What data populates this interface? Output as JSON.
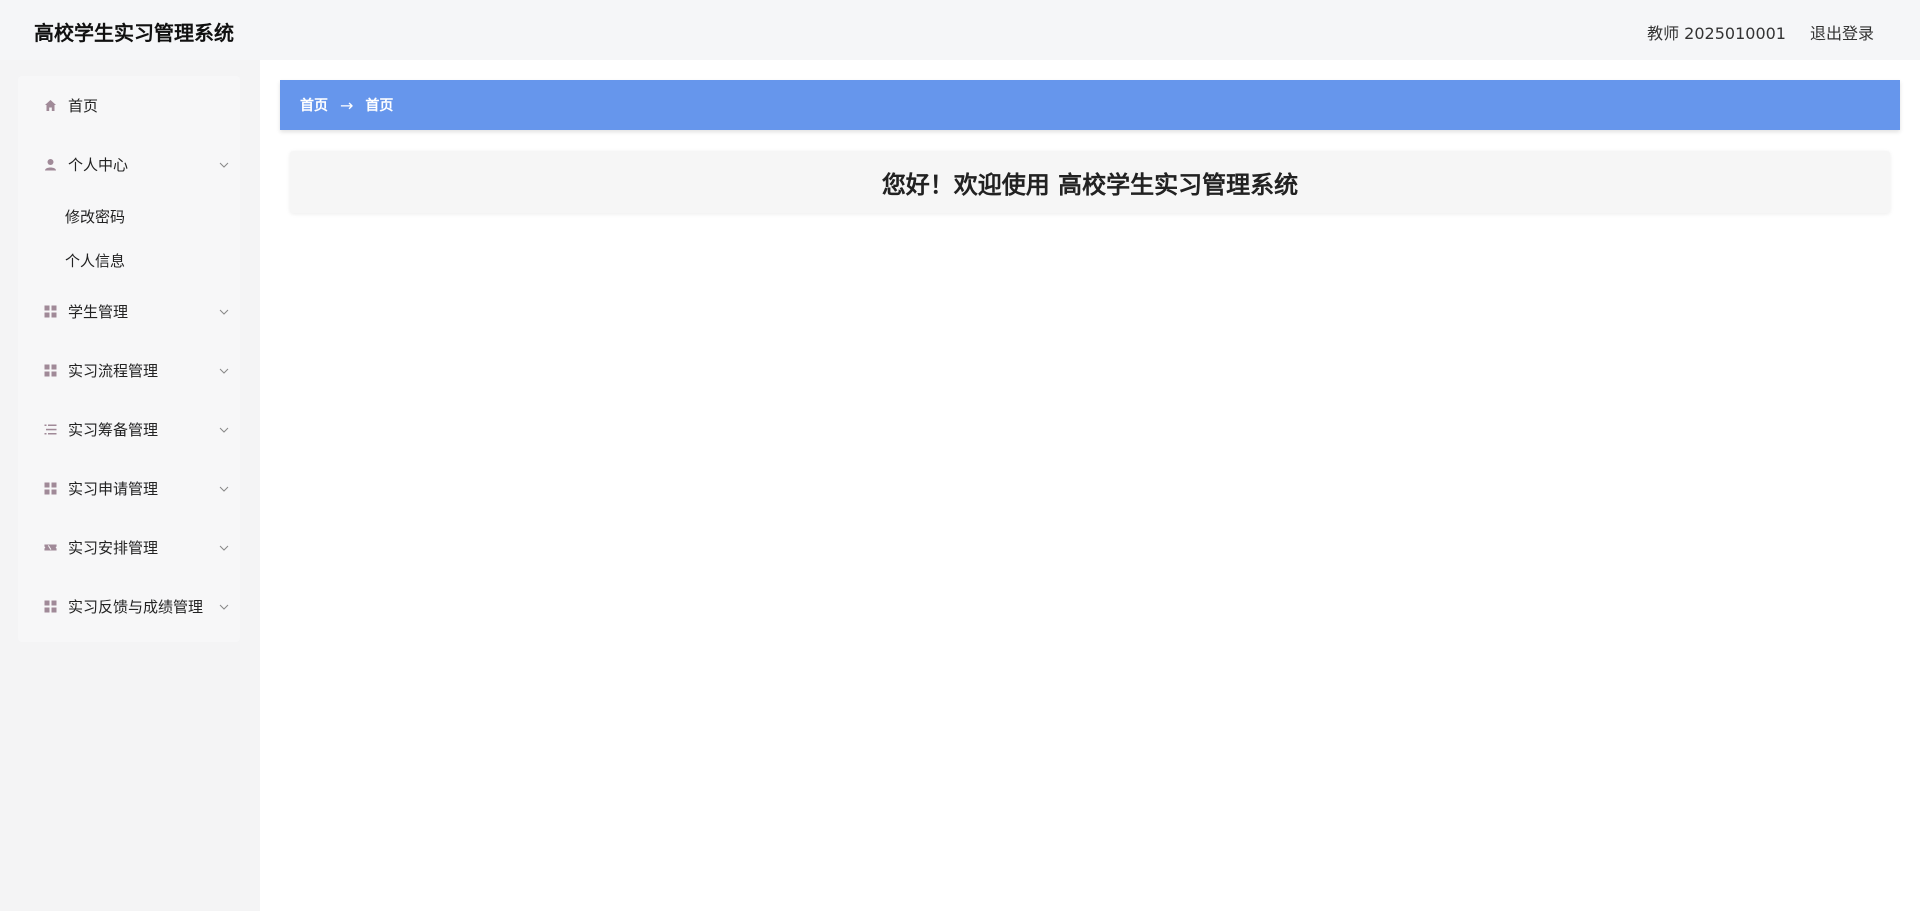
{
  "header": {
    "title": "高校学生实习管理系统",
    "user": "教师 2025010001",
    "logout": "退出登录"
  },
  "sidebar": {
    "items": [
      {
        "label": "首页",
        "icon": "home-icon"
      },
      {
        "label": "个人中心",
        "icon": "user-icon",
        "expanded": true,
        "children": [
          {
            "label": "修改密码"
          },
          {
            "label": "个人信息"
          }
        ]
      },
      {
        "label": "学生管理",
        "icon": "grid-icon"
      },
      {
        "label": "实习流程管理",
        "icon": "grid-icon"
      },
      {
        "label": "实习筹备管理",
        "icon": "list-icon"
      },
      {
        "label": "实习申请管理",
        "icon": "grid-icon"
      },
      {
        "label": "实习安排管理",
        "icon": "ticket-icon"
      },
      {
        "label": "实习反馈与成绩管理",
        "icon": "grid-icon"
      }
    ]
  },
  "breadcrumb": {
    "root": "首页",
    "arrow": "→",
    "current": "首页"
  },
  "main": {
    "welcome": "您好！欢迎使用 高校学生实习管理系统"
  },
  "colors": {
    "breadcrumb_bg": "#6696ec",
    "icon": "#a08a98"
  }
}
